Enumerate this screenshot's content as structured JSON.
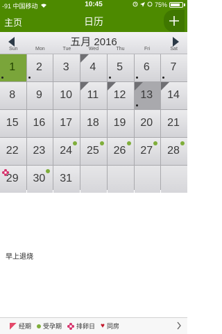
{
  "status_bar": {
    "carrier": "-91 中国移动",
    "time": "10:45",
    "battery": "75%"
  },
  "nav": {
    "back_label": "主页",
    "title": "日历",
    "add_label": "+"
  },
  "calendar": {
    "month_title": "五月 2016",
    "weekdays": [
      "Sun",
      "Mon",
      "Tue",
      "Wed",
      "Thu",
      "Fri",
      "Sat"
    ],
    "days": [
      {
        "n": "1",
        "today": true,
        "dot": true
      },
      {
        "n": "2",
        "dot": true
      },
      {
        "n": "3"
      },
      {
        "n": "4",
        "corner": true
      },
      {
        "n": "5",
        "dot": true
      },
      {
        "n": "6",
        "dot": true
      },
      {
        "n": "7",
        "dot": true
      },
      {
        "n": "8"
      },
      {
        "n": "9"
      },
      {
        "n": "10"
      },
      {
        "n": "11",
        "corner": true
      },
      {
        "n": "12",
        "corner": true
      },
      {
        "n": "13",
        "selected": true,
        "corner": true,
        "dot": true
      },
      {
        "n": "14",
        "corner": true
      },
      {
        "n": "15"
      },
      {
        "n": "16"
      },
      {
        "n": "17"
      },
      {
        "n": "18"
      },
      {
        "n": "19"
      },
      {
        "n": "20"
      },
      {
        "n": "21"
      },
      {
        "n": "22"
      },
      {
        "n": "23"
      },
      {
        "n": "24",
        "green": true
      },
      {
        "n": "25",
        "green": true
      },
      {
        "n": "26",
        "green": true
      },
      {
        "n": "27",
        "green": true
      },
      {
        "n": "28",
        "green": true
      },
      {
        "n": "29",
        "flower": true
      },
      {
        "n": "30",
        "green": true
      },
      {
        "n": "31"
      },
      {
        "n": ""
      },
      {
        "n": ""
      },
      {
        "n": ""
      },
      {
        "n": ""
      }
    ]
  },
  "note": "早上退烧",
  "legend": {
    "period": "经期",
    "fertile": "受孕期",
    "ovulation": "排卵日",
    "intercourse": "同房"
  },
  "colors": {
    "brand_green": "#4d8a00",
    "today_green": "#7aa53a",
    "fertile_green": "#7fae3b",
    "period_pink": "#e44a6a"
  }
}
